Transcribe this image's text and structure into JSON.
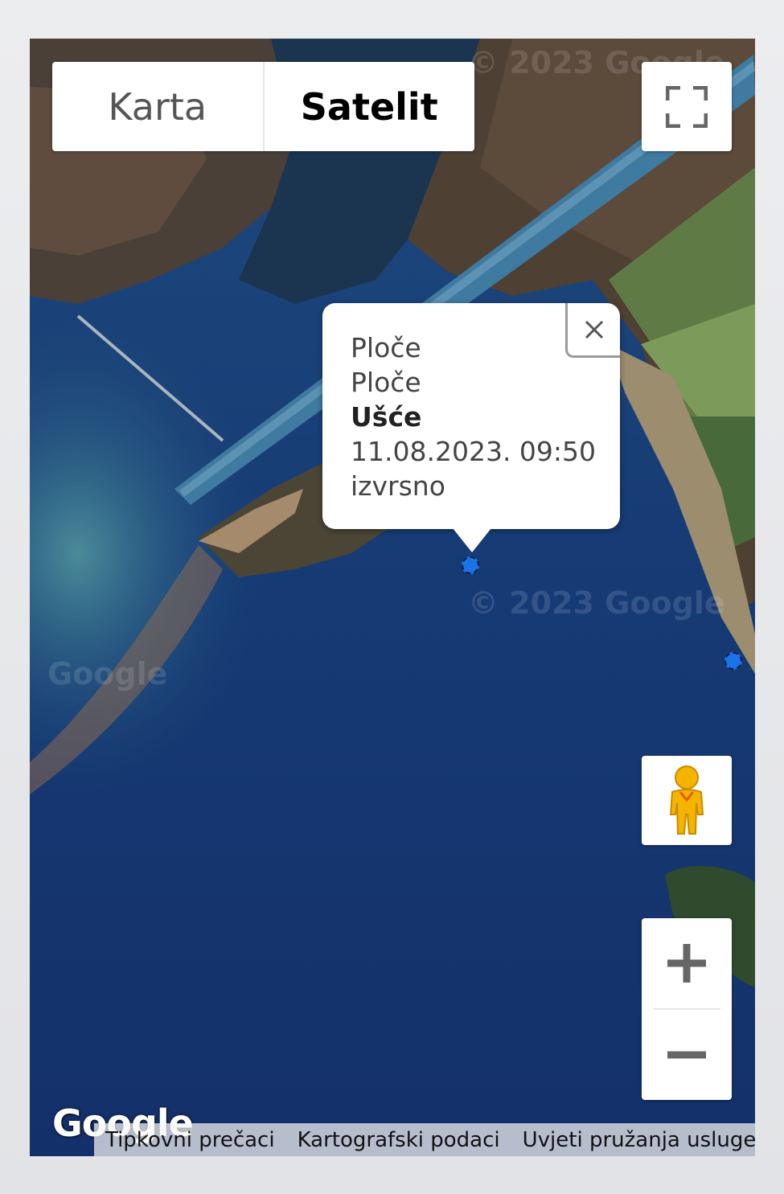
{
  "map_type_control": {
    "options": [
      {
        "label": "Karta",
        "active": false
      },
      {
        "label": "Satelit",
        "active": true
      }
    ]
  },
  "controls": {
    "fullscreen_icon": "fullscreen-icon",
    "street_view_icon": "pegman-icon",
    "zoom_in_icon": "plus-icon",
    "zoom_out_icon": "minus-icon"
  },
  "info_window": {
    "lines": [
      "Ploče",
      "Ploče",
      "Ušće",
      "11.08.2023. 09:50",
      "izvrsno"
    ],
    "bold_line": "Ušće",
    "close_icon": "close-icon"
  },
  "watermarks": [
    "© 2023 Google",
    "© 2023 Google",
    "Google"
  ],
  "google_logo": "Google",
  "footer": {
    "links": [
      "Tipkovni prečaci",
      "Kartografski podaci",
      "Uvjeti pružanja usluge"
    ]
  },
  "colors": {
    "water": "#163a74",
    "marker": "#1a73e8",
    "land": "#5b4a3e",
    "field": "#6f8a4a"
  }
}
